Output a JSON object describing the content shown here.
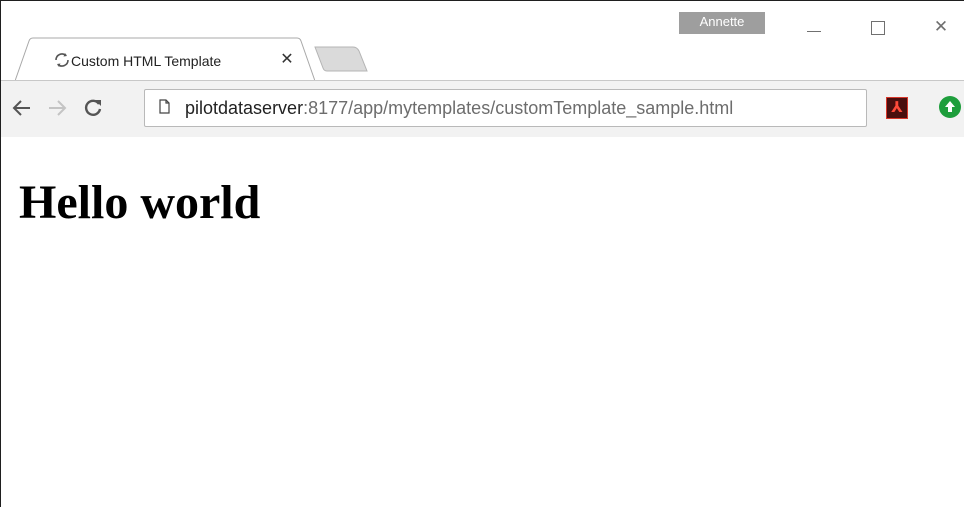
{
  "window": {
    "profile_name": "Annette",
    "controls": [
      "minimize",
      "maximize",
      "close"
    ]
  },
  "tabs": [
    {
      "title": "Custom HTML Template",
      "icon": "loading-icon",
      "active": true
    }
  ],
  "toolbar": {
    "url_host": "pilotdataserver",
    "url_rest": ":8177/app/mytemplates/customTemplate_sample.html",
    "extensions": [
      "adobe-acrobat-icon",
      "green-upload-icon"
    ]
  },
  "page": {
    "heading": "Hello world"
  },
  "colors": {
    "profile_badge": "#9e9e9e",
    "toolbar_bg": "#f2f2f2",
    "pdf_ext": "#d8372b",
    "green_ext": "#1e9e3c"
  }
}
